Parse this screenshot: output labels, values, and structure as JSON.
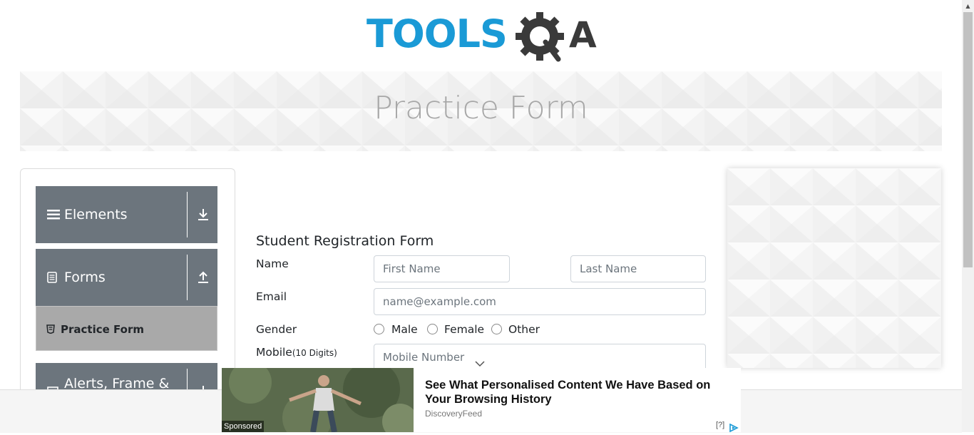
{
  "logo": {
    "text_left": "TOOLS",
    "text_right": "A"
  },
  "banner": {
    "title": "Practice Form"
  },
  "sidebar": {
    "groups": [
      {
        "label": "Elements",
        "icon": "hamburger-icon",
        "arrow": "download-arrow-icon"
      },
      {
        "label": "Forms",
        "icon": "document-icon",
        "arrow": "upload-arrow-icon"
      },
      {
        "label": "Alerts, Frame & Windows",
        "icon": "window-icon",
        "arrow": "download-arrow-icon"
      }
    ],
    "active_item": {
      "label": "Practice Form",
      "icon": "html5-badge-icon"
    }
  },
  "form": {
    "title": "Student Registration Form",
    "name_label": "Name",
    "first_name_placeholder": "First Name",
    "last_name_placeholder": "Last Name",
    "email_label": "Email",
    "email_placeholder": "name@example.com",
    "gender_label": "Gender",
    "gender_options": [
      "Male",
      "Female",
      "Other"
    ],
    "mobile_label": "Mobile",
    "mobile_hint": "(10 Digits)",
    "mobile_placeholder": "Mobile Number"
  },
  "ad": {
    "headline": "See What Personalised Content We Have Based on Your Browsing History",
    "source": "DiscoveryFeed",
    "sponsored": "Sponsored",
    "help": "[?]"
  },
  "colors": {
    "sidebar_header": "#6c757d",
    "sidebar_active": "#a9a9a9",
    "logo_blue": "#1a9ad6",
    "logo_dark": "#3a3a3a",
    "banner_title": "#a7a7a7"
  }
}
